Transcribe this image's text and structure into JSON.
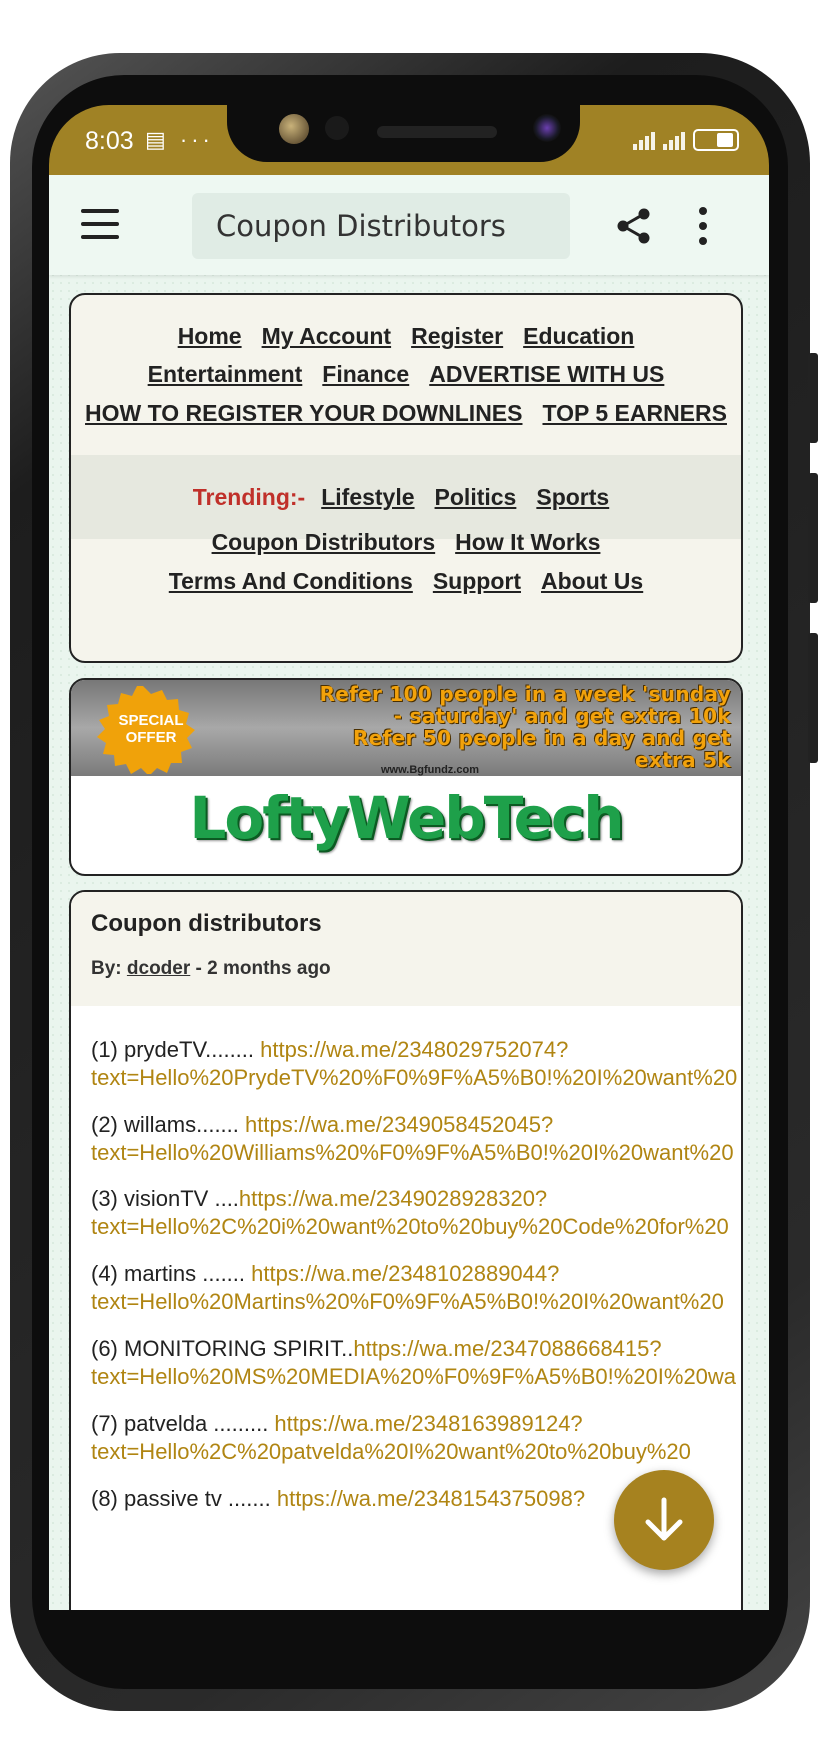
{
  "status_bar": {
    "time": "8:03",
    "left_icons": "▤ ···"
  },
  "app_bar": {
    "title": "Coupon Distributors"
  },
  "nav_menu": {
    "row1": [
      "Home",
      "My Account",
      "Register",
      "Education"
    ],
    "row2": [
      "Entertainment",
      "Finance",
      "ADVERTISE WITH US"
    ],
    "row3": [
      "HOW TO REGISTER YOUR DOWNLINES",
      "TOP 5 EARNERS"
    ],
    "trending_label": "Trending:-",
    "trending": [
      "Lifestyle",
      "Politics",
      "Sports"
    ],
    "row4": [
      "Coupon Distributors",
      "How It Works"
    ],
    "row5": [
      "Terms And Conditions",
      "Support",
      "About Us"
    ]
  },
  "banner": {
    "badge_text": "SPECIAL OFFER",
    "line1": "Refer 100 people in a week 'sunday",
    "line2": "- saturday' and get extra 10k",
    "line3": "Refer 50 people in a day and get",
    "line4": "extra 5k",
    "site": "www.Bgfundz.com",
    "brand": "LoftyWebTech"
  },
  "post": {
    "title": "Coupon distributors",
    "by_label": "By:",
    "author": "dcoder",
    "age": "- 2 months ago",
    "entries": [
      {
        "label": "(1) prydeTV........ ",
        "link1": "https://wa.me/2348029752074?",
        "link2": "text=Hello%20PrydeTV%20%F0%9F%A5%B0!%20I%20want%20"
      },
      {
        "label": "(2) willams.......    ",
        "link1": "https://wa.me/2349058452045?",
        "link2": "text=Hello%20Williams%20%F0%9F%A5%B0!%20I%20want%20"
      },
      {
        "label": "(3) visionTV ....",
        "link1": "https://wa.me/2349028928320?",
        "link2": "text=Hello%2C%20i%20want%20to%20buy%20Code%20for%20"
      },
      {
        "label": "(4) martins ....... ",
        "link1": "https://wa.me/2348102889044?",
        "link2": "text=Hello%20Martins%20%F0%9F%A5%B0!%20I%20want%20"
      },
      {
        "label": "(6) MONITORING SPIRIT..",
        "link1": "https://wa.me/2347088668415?",
        "link2": "text=Hello%20MS%20MEDIA%20%F0%9F%A5%B0!%20I%20wa"
      },
      {
        "label": "(7) patvelda ......... ",
        "link1": "https://wa.me/2348163989124?",
        "link2": "text=Hello%2C%20patvelda%20I%20want%20to%20buy%20"
      },
      {
        "label": "(8) passive tv ....... ",
        "link1": "https://wa.me/2348154375098?",
        "link2": ""
      }
    ]
  },
  "colors": {
    "status_bar": "#a08225",
    "link": "#b08512",
    "trending": "#c0302a",
    "brand": "#1ea04a",
    "fab": "#a6821f"
  }
}
